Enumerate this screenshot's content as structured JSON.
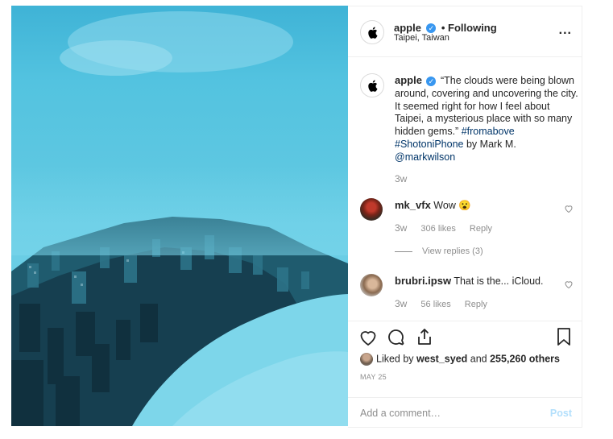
{
  "post": {
    "username": "apple",
    "following_label": "• Following",
    "location": "Taipei, Taiwan",
    "more_label": "...",
    "caption": {
      "username": "apple",
      "text": "“The clouds were being blown around, covering and uncovering the city. It seemed right for how I feel about Taipei, a mysterious place with so many hidden gems.”",
      "hashtag1": "#fromabove",
      "hashtag2": "#ShotoniPhone",
      "byline": "by Mark M.",
      "mention": "@markwilson",
      "time": "3w"
    },
    "comments": [
      {
        "username": "mk_vfx",
        "text": "Wow 😮",
        "time": "3w",
        "likes": "306 likes",
        "reply": "Reply"
      },
      {
        "username": "brubri.ipsw",
        "text": "That is the... iCloud.",
        "time": "3w",
        "likes": "56 likes",
        "reply": "Reply"
      }
    ],
    "view_replies": "View replies (3)",
    "liked_by_prefix": "Liked by",
    "liked_by_user": "west_syed",
    "liked_by_and": "and",
    "liked_by_count": "255,260 others",
    "date": "MAY 25",
    "add_comment_placeholder": "Add a comment…",
    "post_button": "Post"
  },
  "icons": [
    "apple-logo-icon",
    "verified-icon",
    "more-icon",
    "heart-icon",
    "comment-icon",
    "share-icon",
    "bookmark-icon"
  ],
  "colors": {
    "link": "#003569",
    "verified": "#3897f0",
    "muted": "#8e8e8e",
    "post_disabled": "#b2dffc"
  }
}
